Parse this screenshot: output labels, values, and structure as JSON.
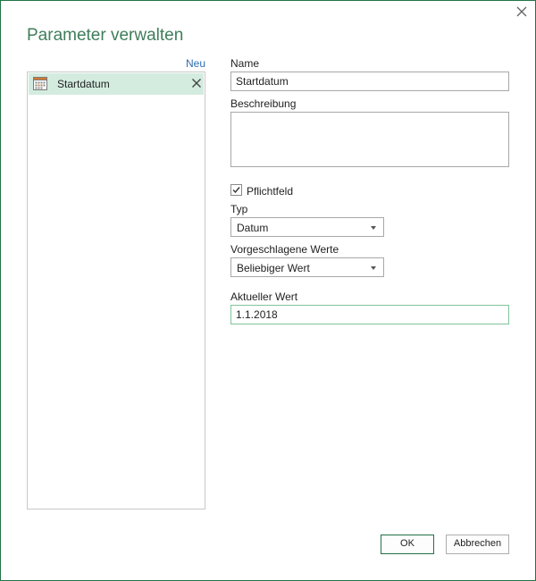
{
  "dialog": {
    "title": "Parameter verwalten",
    "new_link": "Neu"
  },
  "parameters": [
    {
      "label": "Startdatum",
      "icon": "calendar-icon",
      "selected": true
    }
  ],
  "form": {
    "name_label": "Name",
    "name_value": "Startdatum",
    "description_label": "Beschreibung",
    "description_value": "",
    "required_label": "Pflichtfeld",
    "required_checked": true,
    "type_label": "Typ",
    "type_value": "Datum",
    "suggested_label": "Vorgeschlagene Werte",
    "suggested_value": "Beliebiger Wert",
    "current_label": "Aktueller Wert",
    "current_value": "1.1.2018"
  },
  "buttons": {
    "ok": "OK",
    "cancel": "Abbrechen"
  },
  "colors": {
    "accent": "#217346",
    "title": "#3f7d5a",
    "selection": "#d3ecdf",
    "link": "#2f6fb0"
  }
}
